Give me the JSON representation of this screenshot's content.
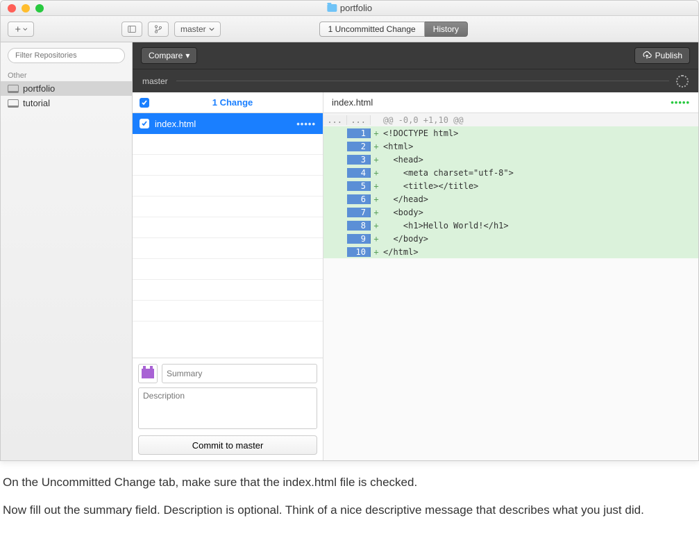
{
  "window": {
    "title": "portfolio"
  },
  "toolbar": {
    "branch_label": "master",
    "tabs": {
      "changes": "1 Uncommitted Change",
      "history": "History"
    }
  },
  "sidebar": {
    "filter_placeholder": "Filter Repositories",
    "section": "Other",
    "repos": [
      {
        "name": "portfolio",
        "selected": true
      },
      {
        "name": "tutorial",
        "selected": false
      }
    ]
  },
  "darkbar": {
    "compare": "Compare",
    "publish": "Publish",
    "branch": "master"
  },
  "changes": {
    "header": "1 Change",
    "file": "index.html"
  },
  "commit": {
    "summary_placeholder": "Summary",
    "description_placeholder": "Description",
    "button": "Commit to master"
  },
  "diff": {
    "filename": "index.html",
    "hunk": "@@ -0,0 +1,10 @@",
    "lines": [
      {
        "n": "1",
        "code": "<!DOCTYPE html>"
      },
      {
        "n": "2",
        "code": "<html>"
      },
      {
        "n": "3",
        "code": "  <head>"
      },
      {
        "n": "4",
        "code": "    <meta charset=\"utf-8\">"
      },
      {
        "n": "5",
        "code": "    <title></title>"
      },
      {
        "n": "6",
        "code": "  </head>"
      },
      {
        "n": "7",
        "code": "  <body>"
      },
      {
        "n": "8",
        "code": "    <h1>Hello World!</h1>"
      },
      {
        "n": "9",
        "code": "  </body>"
      },
      {
        "n": "10",
        "code": "</html>"
      }
    ]
  },
  "instructions": {
    "p1": "On the Uncommitted Change tab, make sure that the index.html file is checked.",
    "p2": "Now fill out the summary field. Description is optional. Think of a nice descriptive message that describes what you just did."
  }
}
